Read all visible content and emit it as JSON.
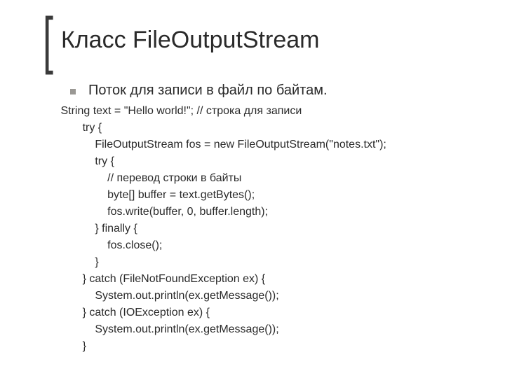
{
  "title": "Класс FileOutputStream",
  "bullet": "Поток для записи в файл по байтам.",
  "code_lines": [
    " String text = \"Hello world!\"; // строка для записи",
    "        try {",
    "            FileOutputStream fos = new FileOutputStream(\"notes.txt\");",
    "            try {",
    "                // перевод строки в байты",
    "                byte[] buffer = text.getBytes();",
    "                fos.write(buffer, 0, buffer.length);",
    "            } finally {",
    "                fos.close();",
    "            }",
    "        } catch (FileNotFoundException ex) {",
    "            System.out.println(ex.getMessage());",
    "        } catch (IOException ex) {",
    "            System.out.println(ex.getMessage());",
    "        }"
  ]
}
